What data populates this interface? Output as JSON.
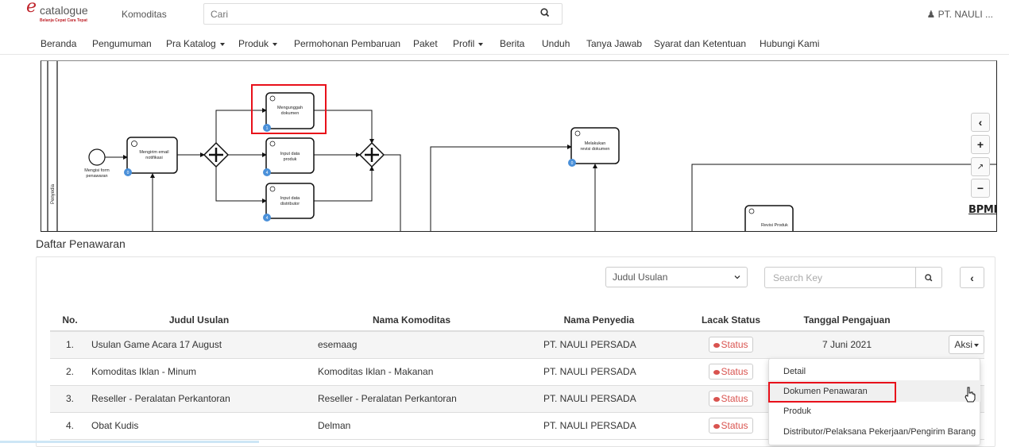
{
  "header": {
    "logo_text": "catalogue",
    "logo_tagline": "Belanja Cepat Cara Tepat",
    "komoditas_label": "Komoditas",
    "search_placeholder": "Cari",
    "user_name": "PT. NAULI ..."
  },
  "nav": [
    {
      "label": "Beranda",
      "dropdown": false
    },
    {
      "label": "Pengumuman",
      "dropdown": false
    },
    {
      "label": "Pra Katalog",
      "dropdown": true
    },
    {
      "label": "Produk",
      "dropdown": true
    },
    {
      "label": "Permohonan Pembaruan",
      "dropdown": false
    },
    {
      "label": "Paket",
      "dropdown": false
    },
    {
      "label": "Profil",
      "dropdown": true
    },
    {
      "label": "Berita",
      "dropdown": false
    },
    {
      "label": "Unduh",
      "dropdown": false
    },
    {
      "label": "Tanya Jawab",
      "dropdown": false
    },
    {
      "label": "Syarat dan Ketentuan",
      "dropdown": false
    },
    {
      "label": "Hubungi Kami",
      "dropdown": false
    }
  ],
  "diagram": {
    "lane_label": "Penyedia",
    "start_event_label": "Mengisi form penawaran",
    "tasks": [
      {
        "label": "Mengirim email notifikasi",
        "badge": "0"
      },
      {
        "label": "Mengunggah dokumen",
        "badge": "1"
      },
      {
        "label": "Input data produk",
        "badge": "4"
      },
      {
        "label": "Input data distributor",
        "badge": "4"
      },
      {
        "label": "Melakukan revisi dokumen",
        "badge": "0"
      },
      {
        "label": "Revisi Produk",
        "badge": ""
      }
    ],
    "logo": "BPMN.iO"
  },
  "section_title": "Daftar Penawaran",
  "filter": {
    "select_value": "Judul Usulan",
    "search_placeholder": "Search Key"
  },
  "table": {
    "headers": [
      "No.",
      "Judul Usulan",
      "Nama Komoditas",
      "Nama Penyedia",
      "Lacak Status",
      "Tanggal Pengajuan",
      ""
    ],
    "rows": [
      {
        "no": "1.",
        "judul": "Usulan Game Acara 17 August",
        "komoditas": "esemaag",
        "penyedia": "PT. NAULI PERSADA",
        "status": "Status",
        "tanggal": "7 Juni 2021",
        "aksi": "Aksi"
      },
      {
        "no": "2.",
        "judul": "Komoditas Iklan - Minum",
        "komoditas": "Komoditas Iklan - Makanan",
        "penyedia": "PT. NAULI PERSADA",
        "status": "Status",
        "tanggal": "",
        "aksi": ""
      },
      {
        "no": "3.",
        "judul": "Reseller - Peralatan Perkantoran",
        "komoditas": "Reseller - Peralatan Perkantoran",
        "penyedia": "PT. NAULI PERSADA",
        "status": "Status",
        "tanggal": "",
        "aksi": ""
      },
      {
        "no": "4.",
        "judul": "Obat Kudis",
        "komoditas": "Delman",
        "penyedia": "PT. NAULI PERSADA",
        "status": "Status",
        "tanggal": "",
        "aksi": ""
      }
    ]
  },
  "aksi_menu": [
    "Detail",
    "Dokumen Penawaran",
    "Produk",
    "Distributor/Pelaksana Pekerjaan/Pengirim Barang"
  ],
  "colors": {
    "highlight_red": "#e8101a",
    "status_red": "#d9534f",
    "badge_blue": "#4a90d9"
  }
}
